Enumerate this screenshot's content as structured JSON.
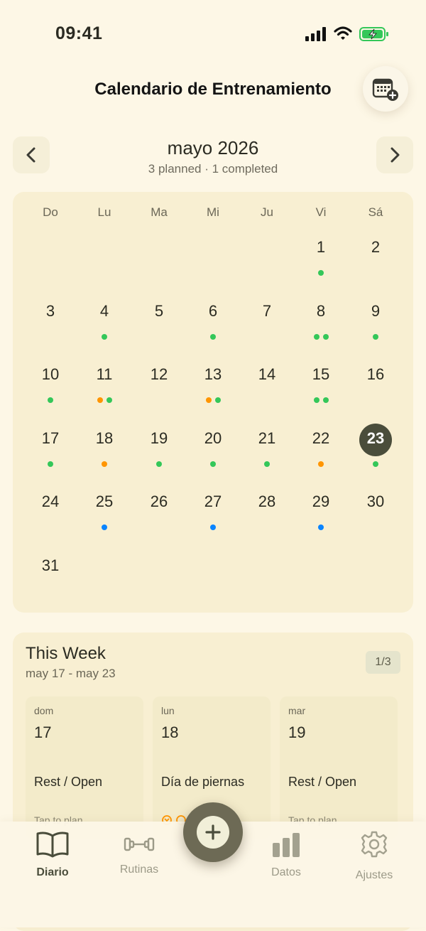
{
  "status_bar": {
    "time": "09:41"
  },
  "header": {
    "title": "Calendario de Entrenamiento",
    "add_icon": "calendar-plus-icon"
  },
  "month_nav": {
    "title": "mayo 2026",
    "subtitle": "3 planned · 1 completed",
    "prev_icon": "chevron-left-icon",
    "next_icon": "chevron-right-icon"
  },
  "colors": {
    "completed": "#34c759",
    "missed": "#ff9500",
    "planned": "#0a84ff",
    "selected_bg": "#4a4d3b",
    "background": "#fdf7e6",
    "card": "#f8efd2"
  },
  "calendar": {
    "weekdays": [
      "Do",
      "Lu",
      "Ma",
      "Mi",
      "Ju",
      "Vi",
      "Sá"
    ],
    "days": [
      {
        "day": "1",
        "dots": [
          "completed"
        ]
      },
      {
        "day": "2",
        "dots": []
      },
      {
        "day": "3",
        "dots": []
      },
      {
        "day": "4",
        "dots": [
          "completed"
        ]
      },
      {
        "day": "5",
        "dots": []
      },
      {
        "day": "6",
        "dots": [
          "completed"
        ]
      },
      {
        "day": "7",
        "dots": []
      },
      {
        "day": "8",
        "dots": [
          "completed",
          "completed"
        ]
      },
      {
        "day": "9",
        "dots": [
          "completed"
        ]
      },
      {
        "day": "10",
        "dots": [
          "completed"
        ]
      },
      {
        "day": "11",
        "dots": [
          "missed",
          "completed"
        ]
      },
      {
        "day": "12",
        "dots": []
      },
      {
        "day": "13",
        "dots": [
          "missed",
          "completed"
        ]
      },
      {
        "day": "14",
        "dots": []
      },
      {
        "day": "15",
        "dots": [
          "completed",
          "completed"
        ]
      },
      {
        "day": "16",
        "dots": []
      },
      {
        "day": "17",
        "dots": [
          "completed"
        ]
      },
      {
        "day": "18",
        "dots": [
          "missed"
        ]
      },
      {
        "day": "19",
        "dots": [
          "completed"
        ]
      },
      {
        "day": "20",
        "dots": [
          "completed"
        ]
      },
      {
        "day": "21",
        "dots": [
          "completed"
        ]
      },
      {
        "day": "22",
        "dots": [
          "missed"
        ]
      },
      {
        "day": "23",
        "dots": [
          "completed"
        ],
        "selected": true
      },
      {
        "day": "24",
        "dots": []
      },
      {
        "day": "25",
        "dots": [
          "planned"
        ]
      },
      {
        "day": "26",
        "dots": []
      },
      {
        "day": "27",
        "dots": [
          "planned"
        ]
      },
      {
        "day": "28",
        "dots": []
      },
      {
        "day": "29",
        "dots": [
          "planned"
        ]
      },
      {
        "day": "30",
        "dots": []
      },
      {
        "day": "31",
        "dots": []
      }
    ]
  },
  "this_week": {
    "title": "This Week",
    "range": "may 17 - may 23",
    "badge": "1/3",
    "days": [
      {
        "dow": "dom",
        "num": "17",
        "label": "Rest / Open",
        "sub": "Tap to plan"
      },
      {
        "dow": "lun",
        "num": "18",
        "label": "Día de piernas",
        "sub": ""
      },
      {
        "dow": "mar",
        "num": "19",
        "label": "Rest / Open",
        "sub": "Tap to plan"
      }
    ]
  },
  "tab_bar": {
    "tabs": [
      {
        "label": "Diario",
        "icon": "book-icon",
        "active": true
      },
      {
        "label": "Rutinas",
        "icon": "dumbbell-icon",
        "active": false
      },
      {
        "label": "Datos",
        "icon": "bar-chart-icon",
        "active": false
      },
      {
        "label": "Ajustes",
        "icon": "gear-icon",
        "active": false
      }
    ],
    "fab_icon": "plus-icon"
  }
}
